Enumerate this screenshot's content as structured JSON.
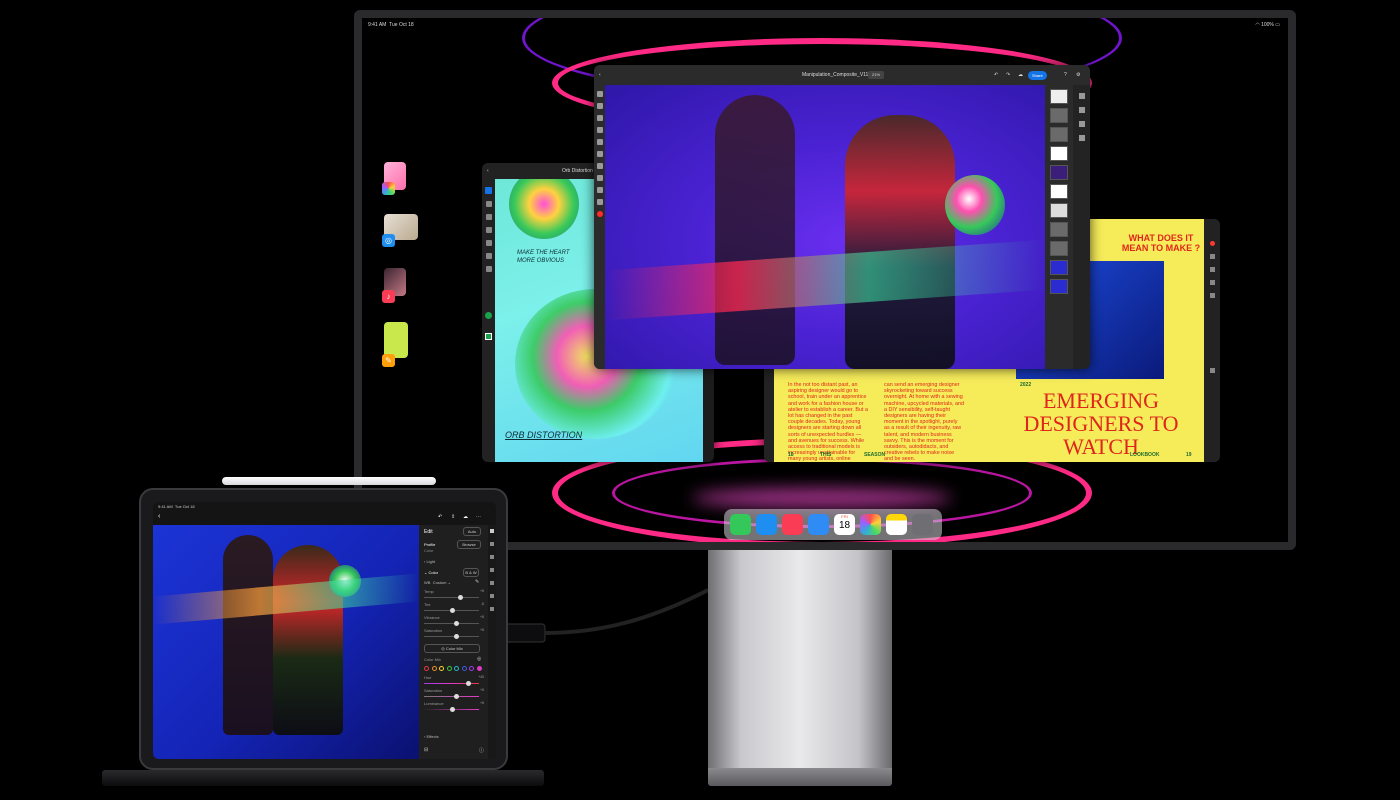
{
  "display": {
    "status_bar": {
      "time": "9:41 AM",
      "date": "Tue Oct 18",
      "battery": "100%"
    },
    "stage_manager": {
      "apps": [
        "photos",
        "safari",
        "music",
        "pages"
      ]
    },
    "photoshop": {
      "file_name": "Manipulation_Composite_V11 *",
      "zoom": "21%",
      "share_label": "Share"
    },
    "fresco": {
      "file_name": "Orb Distortion *",
      "canvas_text_top": "MAKE THE HEART MORE OBVIOUS",
      "canvas_text_bottom": "ORB DISTORTION"
    },
    "indesign": {
      "col1": "In the not too distant past, an aspiring designer would go to school, train under an apprentice and work for a fashion house or atelier to establish a career. But a lot has changed in the past couple decades. Today, young designers are starting down all sorts of unexpected hurdles — and avenues for success. While access to traditional models is increasingly unattainable for many young artists, online exposure",
      "col2": "can send an emerging designer skyrocketing toward success overnight. At home with a sewing machine, upcycled materials, and a DIY sensibility, self-taught designers are having their moment in the spotlight, purely as a result of their ingenuity, raw talent, and modern business savvy. This is the moment for outsiders, autodidacts, and creative rebels to make noise and be seen.",
      "headline_top": "WHAT DOES IT MEAN TO MAKE ?",
      "year": "2022",
      "headline": "EMERGING DESIGNERS TO WATCH",
      "footer_left_num": "18",
      "footer_left_a": "THIS",
      "footer_left_b": "SEASON",
      "footer_right_label": "LOOKBOOK",
      "footer_right_num": "19"
    },
    "dock": {
      "apps": [
        "messages",
        "safari",
        "music",
        "mail",
        "calendar",
        "photos",
        "notes",
        "app-library"
      ],
      "calendar_day": "FRI",
      "calendar_date": "18"
    },
    "colors": {
      "ps_canvas": "#4a22d2",
      "id_page": "#f6ec5a",
      "id_text": "#e0261b",
      "wallpaper_ring": "#e81cc9"
    }
  },
  "ipad": {
    "status_bar": {
      "time": "9:41 AM",
      "date": "Tue Oct 18"
    },
    "lightroom": {
      "panel_title": "Edit",
      "auto_label": "Auto",
      "profile_label": "Profile",
      "profile_value": "Color",
      "browse_label": "Browse",
      "light_label": "Light",
      "color_label": "Color",
      "bw_label": "B & W",
      "wb_label": "WB",
      "wb_value": "Custom",
      "sliders_top": [
        {
          "label": "Temp",
          "value": "+8"
        },
        {
          "label": "Tint",
          "value": "-8"
        },
        {
          "label": "Vibrance",
          "value": "+8"
        },
        {
          "label": "Saturation",
          "value": "+8"
        }
      ],
      "color_mix_button": "Color Mix",
      "color_mix_label": "Color Mix",
      "sliders_bottom": [
        {
          "label": "Hue",
          "value": "+45"
        },
        {
          "label": "Saturation",
          "value": "+8"
        },
        {
          "label": "Luminance",
          "value": "+8"
        }
      ],
      "effects_label": "Effects",
      "swatch_colors": [
        "#e23a3a",
        "#f08a2a",
        "#f2d32a",
        "#3ec43e",
        "#2ab6c8",
        "#3a5ce6",
        "#a23ae6",
        "#e23ac8"
      ]
    }
  }
}
